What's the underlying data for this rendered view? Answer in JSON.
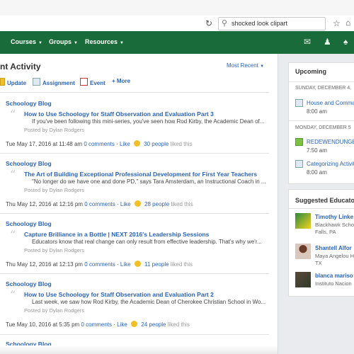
{
  "browser": {
    "search_value": "shocked look clipart"
  },
  "nav": {
    "items": [
      {
        "label": "Courses"
      },
      {
        "label": "Groups"
      },
      {
        "label": "Resources"
      }
    ]
  },
  "main": {
    "title": "nt Activity",
    "sort_label": "Most Recent",
    "post_bar": {
      "update": "Update",
      "assignment": "Assignment",
      "event": "Event",
      "more": "More"
    },
    "entries": [
      {
        "source": "Schoology Blog",
        "title": "How to Use Schoology for Staff Observation and Evaluation Part 3",
        "body": "If you've been following this mini-series, you've seen how Rod Kirby, the Academic Dean of...",
        "by": "Posted by Dylan Rodgers",
        "date": "Tue May 17, 2016 at 11:48 am",
        "comments": "0 comments",
        "like": "Like",
        "people": "30 people",
        "liked": "liked this"
      },
      {
        "source": "Schoology Blog",
        "title": "The Art of Building Exceptional Professional Development for First Year Teachers",
        "body": "\"No longer do we have one and done PD,\" says Tara Amsterdam, an Instructional Coach in ...",
        "by": "Posted by Dylan Rodgers",
        "date": "Thu May 12, 2016 at 12:16 pm",
        "comments": "0 comments",
        "like": "Like",
        "people": "28 people",
        "liked": "liked this"
      },
      {
        "source": "Schoology Blog",
        "title": "Capture Brilliance in a Bottle | NEXT 2016's Leadership Sessions",
        "body": "Educators know that real change can only result from effective leadership. That's why we'r...",
        "by": "Posted by Dylan Rodgers",
        "date": "Thu May 12, 2016 at 12:13 pm",
        "comments": "0 comments",
        "like": "Like",
        "people": "11 people",
        "liked": "liked this"
      },
      {
        "source": "Schoology Blog",
        "title": "How to Use Schoology for Staff Observation and Evaluation Part 2",
        "body": "Last week, we saw how Rod Kirby, the Academic Dean of Cherokee Christian School in Wo...",
        "by": "Posted by Dylan Rodgers",
        "date": "Tue May 10, 2016 at 5:35 pm",
        "comments": "0 comments",
        "like": "Like",
        "people": "24 people",
        "liked": "liked this"
      },
      {
        "source": "Schoology Blog"
      }
    ]
  },
  "upcoming": {
    "title": "Upcoming",
    "days": [
      {
        "header": "SUNDAY, DECEMBER 4,",
        "events": [
          {
            "name": "House and Comma",
            "time": "8:00 am"
          }
        ]
      },
      {
        "header": "MONDAY, DECEMBER 5",
        "events": [
          {
            "name": "REDEWENDUNGEN",
            "time": "7:50 am"
          },
          {
            "name": "Categorizing Activit",
            "time": "8:00 am"
          }
        ]
      }
    ]
  },
  "educators": {
    "title": "Suggested Educato",
    "items": [
      {
        "name": "Timothy Linke",
        "org1": "Blackhawk Scho",
        "org2": "Falls, PA"
      },
      {
        "name": "Shantell Alfor",
        "org1": "Maya Angelou H",
        "org2": "TX"
      },
      {
        "name": "blanca mariso",
        "org1": "Instituto Nacion",
        "org2": ""
      }
    ]
  },
  "colors": {
    "nav": "#1a6b3a",
    "link": "#2b63b8"
  }
}
